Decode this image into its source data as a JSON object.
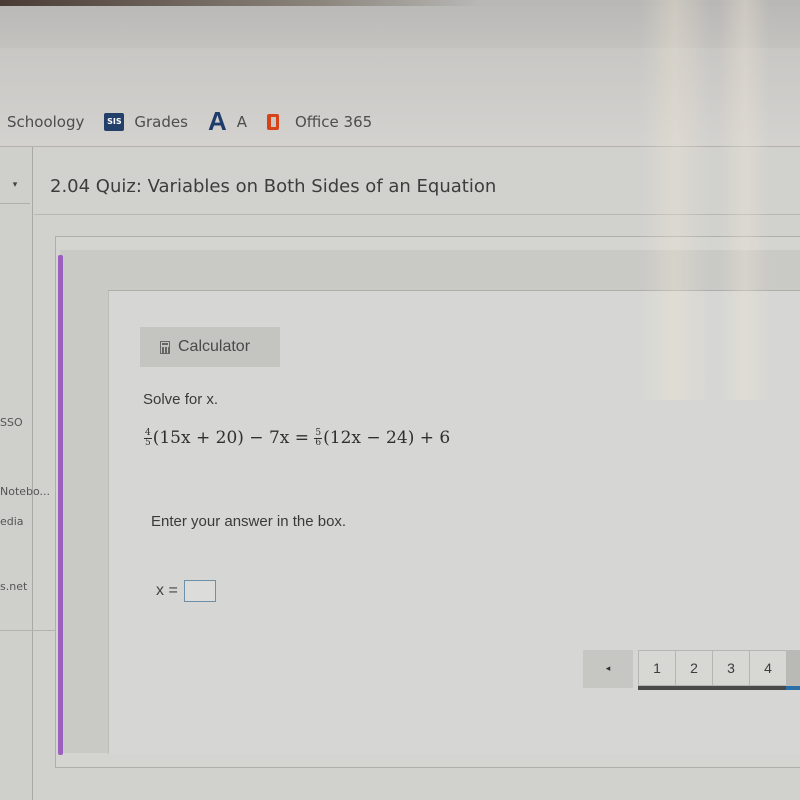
{
  "bookmarks": {
    "items": [
      {
        "label": "Schoology",
        "icon": "schoology-icon"
      },
      {
        "label": "Grades",
        "icon": "sis-icon",
        "icon_text": "SIS"
      },
      {
        "label": "A",
        "icon": "a-logo-icon",
        "icon_text": "A"
      },
      {
        "label": "Office 365",
        "icon": "office-icon"
      }
    ]
  },
  "sidebar": {
    "links": [
      "SSO",
      "Notebo...",
      "edia",
      "s.net"
    ],
    "toggle_icon": "▾"
  },
  "quiz": {
    "title": "2.04 Quiz: Variables on Both Sides of an Equation",
    "calculator_label": "Calculator",
    "prompt": "Solve for x.",
    "equation": {
      "lhs_fraction": {
        "num": "4",
        "den": "5"
      },
      "lhs_rest": "(15x + 20) − 7x = ",
      "rhs_fraction": {
        "num": "5",
        "den": "6"
      },
      "rhs_rest": "(12x − 24) + 6"
    },
    "instruction": "Enter your answer in the box.",
    "answer_label": "x =",
    "answer_value": ""
  },
  "pagination": {
    "prev_icon": "◂",
    "pages": [
      "1",
      "2",
      "3",
      "4"
    ]
  },
  "colors": {
    "accent": "#9b5fc0",
    "sis_brand": "#22406a",
    "office_brand": "#d64319",
    "pager_progress": "#2a6fa8"
  }
}
